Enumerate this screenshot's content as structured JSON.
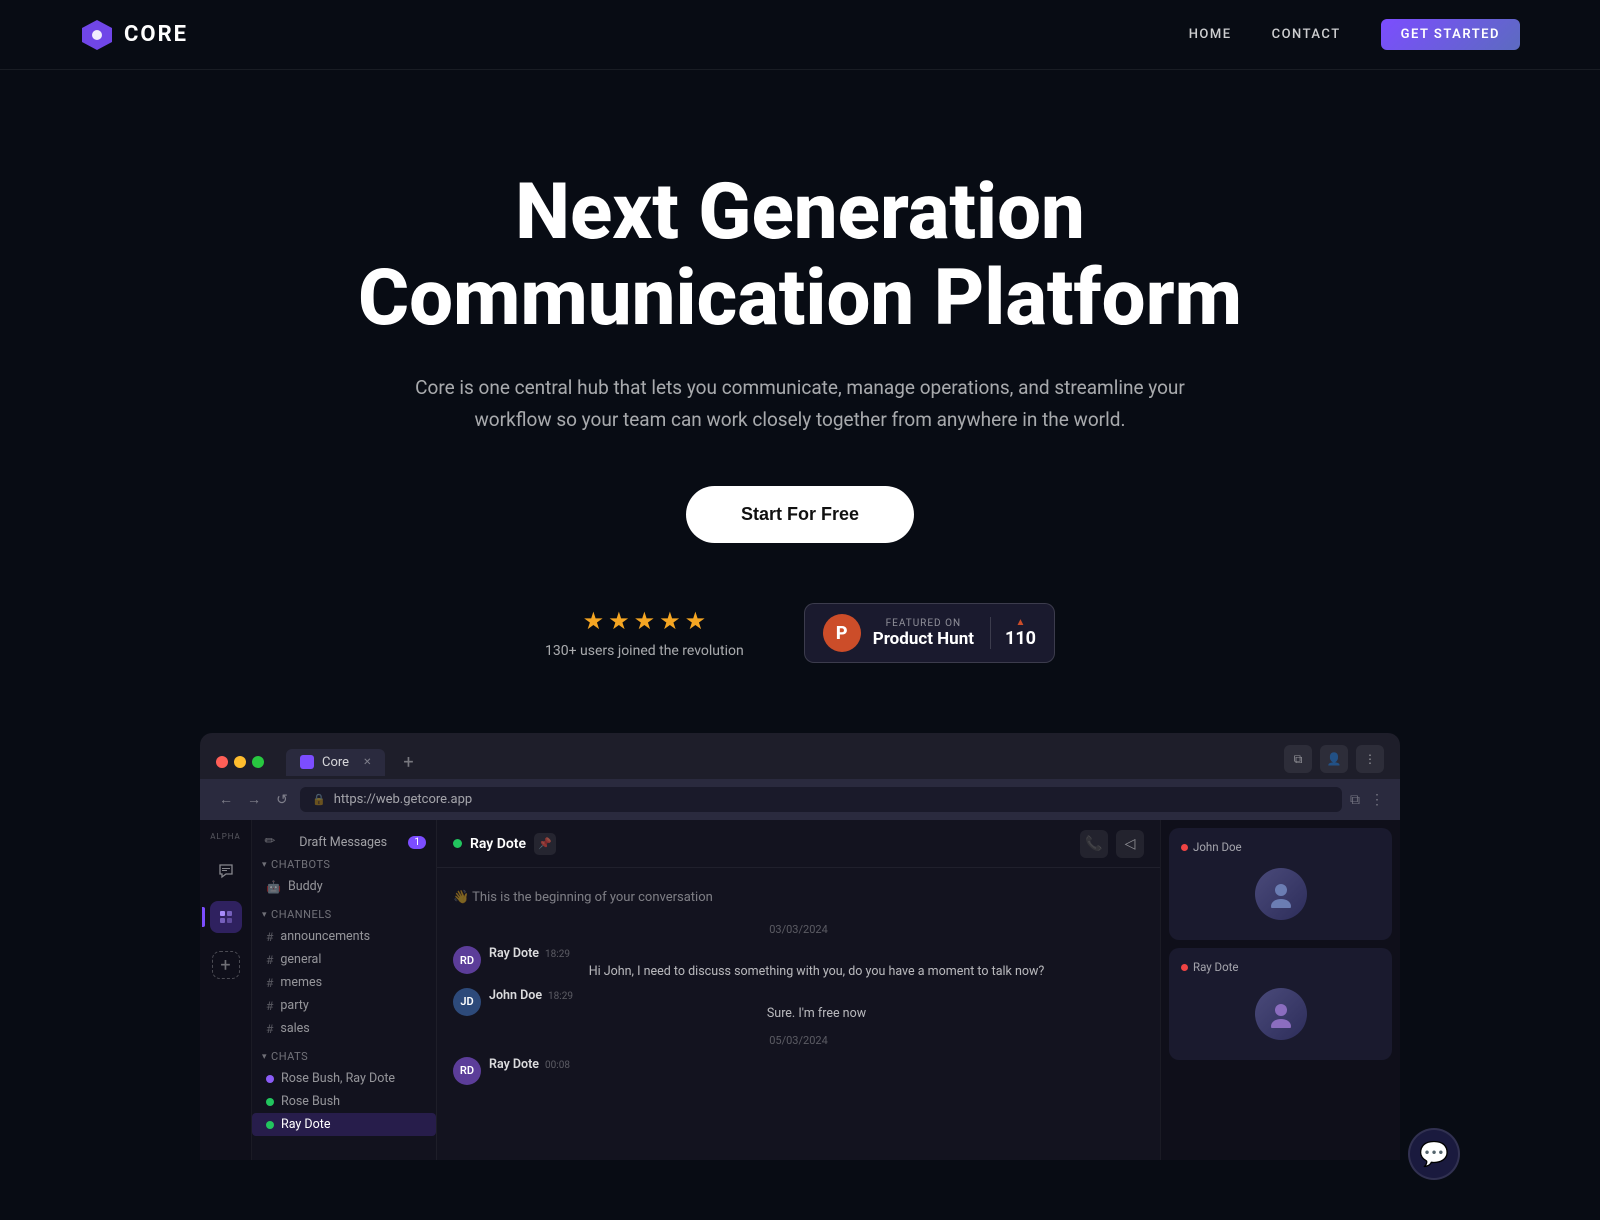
{
  "nav": {
    "logo_text": "CORE",
    "links": [
      "HOME",
      "CONTACT",
      "GET STARTED"
    ]
  },
  "hero": {
    "title_line1": "Next Generation",
    "title_line2": "Communication Platform",
    "subtitle": "Core is one central hub that lets you communicate, manage operations, and streamline your workflow so your team can work closely together from anywhere in the world.",
    "cta_button": "Start For Free",
    "stars_label": "130+ users joined the revolution"
  },
  "product_hunt": {
    "featured_label": "FEATURED ON",
    "name": "Product Hunt",
    "count": "110"
  },
  "app_preview": {
    "tab_title": "Core",
    "url": "https://web.getcore.app",
    "draft_messages": "Draft Messages",
    "draft_count": "1",
    "chatbots_section": "CHATBOTS",
    "buddy": "Buddy",
    "channels_section": "CHANNELS",
    "channels": [
      "announcements",
      "general",
      "memes",
      "party",
      "sales"
    ],
    "chats_section": "CHATS",
    "chats": [
      "Rose Bush, Ray Dote",
      "Rose Bush",
      "Ray Dote"
    ],
    "active_chat_user": "Ray Dote",
    "conversation_start": "👋 This is the beginning of your conversation",
    "date1": "03/03/2024",
    "date2": "05/03/2024",
    "messages": [
      {
        "sender": "Ray Dote",
        "time": "18:29",
        "text": "Hi John, I need to discuss something with you, do you have a moment to talk now?"
      },
      {
        "sender": "John Doe",
        "time": "18:29",
        "text": "Sure. I'm free now"
      },
      {
        "sender": "Ray Dote",
        "time": "00:08",
        "text": ""
      }
    ],
    "call_cards": [
      {
        "user": "John Doe"
      },
      {
        "user": "Ray Dote"
      }
    ]
  }
}
